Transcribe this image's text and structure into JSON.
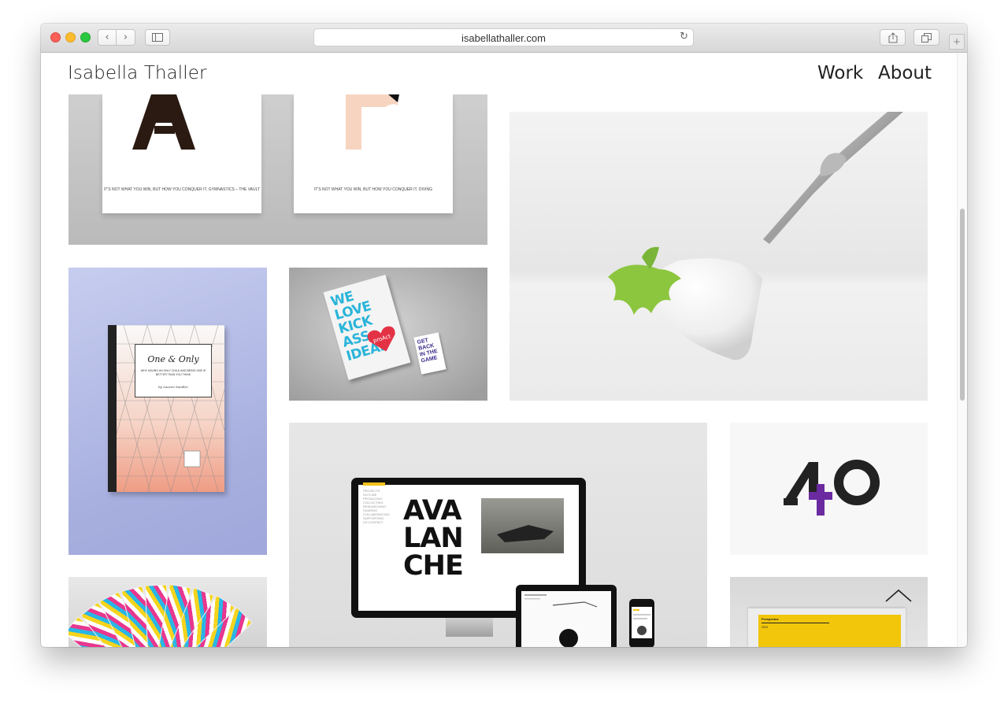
{
  "browser": {
    "url": "isabellathaller.com",
    "back_icon": "‹",
    "forward_icon": "›",
    "reload_icon": "↻",
    "new_tab_icon": "+"
  },
  "site": {
    "title": "Isabella Thaller",
    "nav": [
      {
        "label": "Work"
      },
      {
        "label": "About"
      }
    ]
  },
  "tiles": {
    "posters": {
      "poster1_letter": "A",
      "poster1_caption": "IT'S NOT WHAT YOU WIN, BUT HOW YOU CONQUER IT. GYMNASTICS – THE VAULT",
      "poster2_caption": "IT'S NOT WHAT YOU WIN, BUT HOW YOU CONQUER IT. DIVING"
    },
    "book": {
      "title": "One & Only",
      "subtitle": "WHY HAVING AN ONLY CHILD AND BEING ONE IS BETTER THAN YOU THINK",
      "author": "by Lauren Sandler"
    },
    "kick": {
      "flyer_text": "WE LOVE KICK ASS IDEAS",
      "badge": "proAct",
      "sticker_text": "GET BACK IN THE GAME"
    },
    "avalanche": {
      "headline": "AVA LAN CHE",
      "menu": "PROJECTS OUTLINE PRODUCING COLLECTING RESEARCHING SHARING COLLABORATING SUPPORTING US CONTACT"
    },
    "forty": {
      "left_digit": "4",
      "right_digit": "0"
    },
    "prospectus": {
      "title": "Prospectus",
      "year": "2015"
    }
  },
  "colors": {
    "straw_leaf": "#8cc63f",
    "plus_purple": "#6b2aa0",
    "poster_peach": "#f7d4c0",
    "poster_dark": "#2a1a12"
  }
}
